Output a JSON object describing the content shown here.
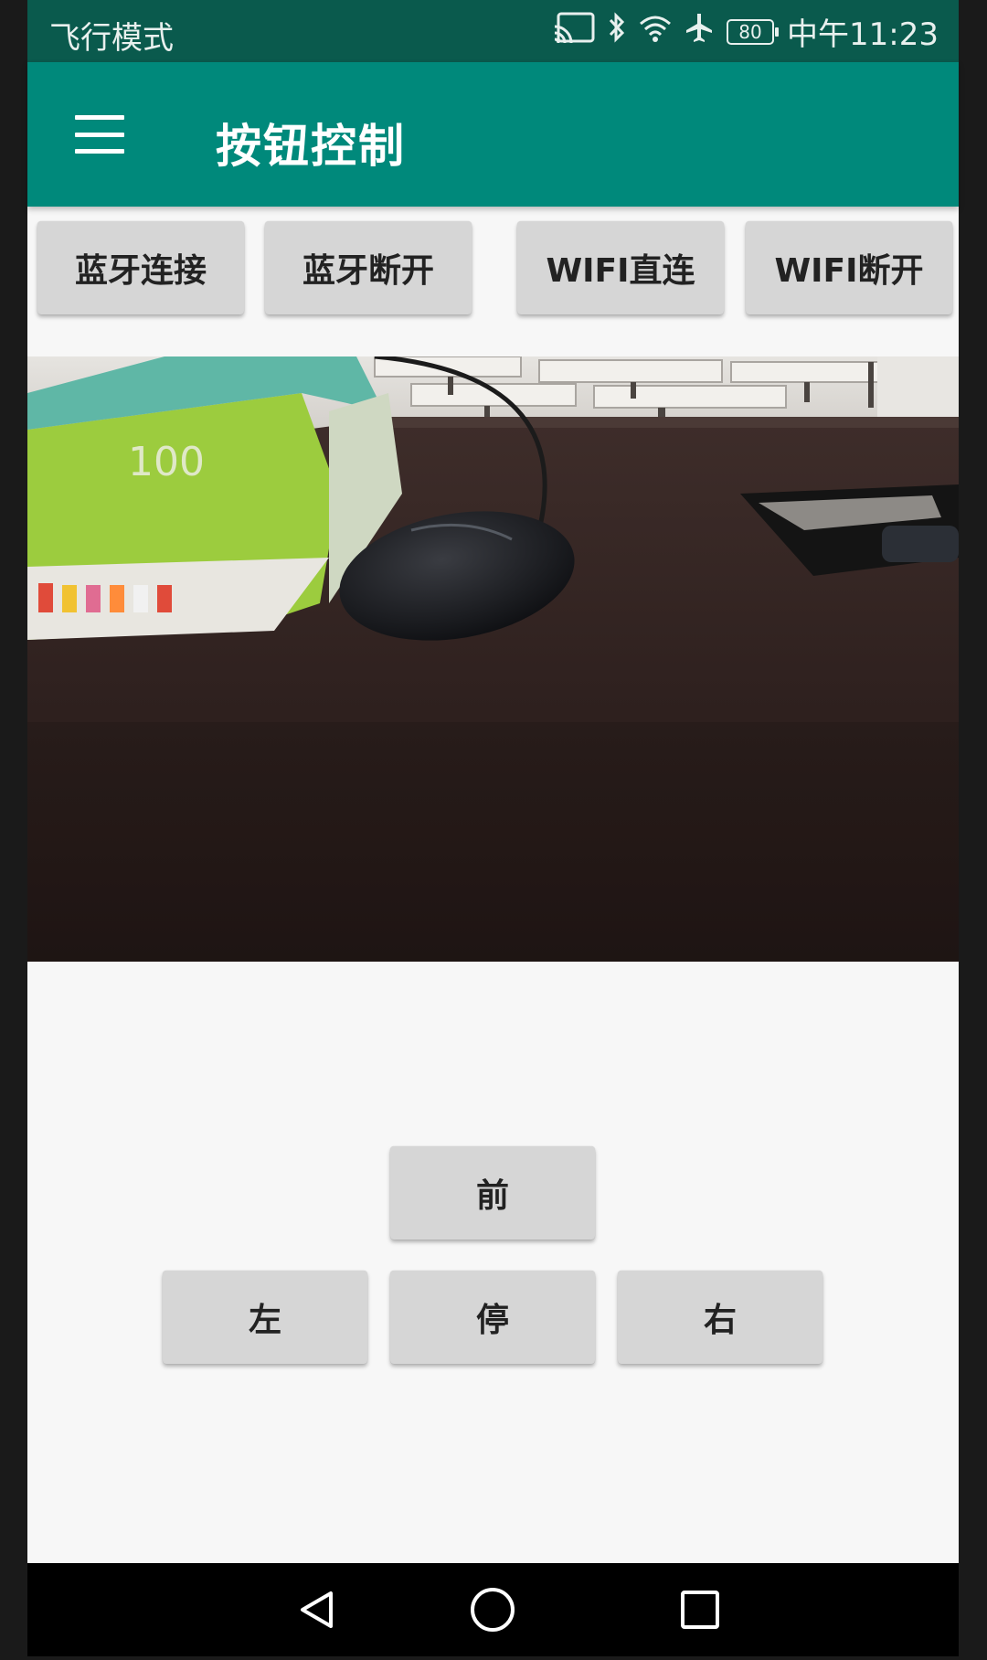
{
  "status_bar": {
    "mode_text": "飞行模式",
    "battery": "80",
    "time": "中午11:23"
  },
  "app_bar": {
    "title": "按钮控制",
    "menu_icon": "hamburger-menu-icon"
  },
  "connection_buttons": [
    "蓝牙连接",
    "蓝牙断开",
    "WIFI直连",
    "WIFI断开"
  ],
  "camera": {
    "description_icon": "camera-feed"
  },
  "direction_buttons": {
    "forward": "前",
    "left": "左",
    "stop": "停",
    "right": "右"
  },
  "nav_bar": {
    "back_icon": "back-triangle-icon",
    "home_icon": "home-circle-icon",
    "recent_icon": "recents-square-icon"
  },
  "colors": {
    "status_bar": "#0a5a4d",
    "app_bar": "#00897b",
    "button_bg": "#d6d6d6",
    "screen_bg": "#f7f7f7"
  }
}
